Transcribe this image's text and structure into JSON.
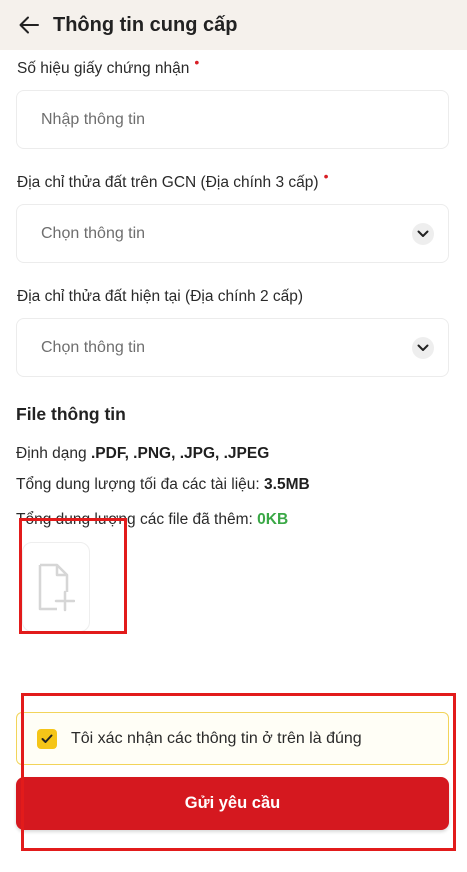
{
  "header": {
    "title": "Thông tin cung cấp",
    "back_icon": "arrow-left-icon"
  },
  "fields": [
    {
      "label": "Số hiệu giấy chứng nhận",
      "required_mark": "•",
      "placeholder": "Nhập thông tin"
    },
    {
      "label": "Địa chỉ thửa đất trên GCN (Địa chính 3 cấp)",
      "required_mark": "•",
      "placeholder": "Chọn thông tin"
    },
    {
      "label": "Địa chỉ thửa đất hiện tại (Địa chính 2 cấp)",
      "placeholder": "Chọn thông tin"
    }
  ],
  "file_section": {
    "title": "File thông tin",
    "format_label": "Định dạng ",
    "format_value": ".PDF, .PNG, .JPG, .JPEG",
    "max_label": "Tổng dung lượng tối đa các tài liệu: ",
    "max_value": "3.5MB",
    "added_label": "Tổng dung lượng các file đã thêm: ",
    "added_value": "0KB",
    "add_icon": "file-add-icon"
  },
  "confirm": {
    "text": "Tôi xác nhận các thông tin ở trên là đúng",
    "checked": true
  },
  "submit": {
    "label": "Gửi yêu cầu"
  },
  "colors": {
    "primary": "#d5181f",
    "checkbox": "#f5c518",
    "highlight_box": "#e21b1b",
    "success": "#3aa846"
  }
}
